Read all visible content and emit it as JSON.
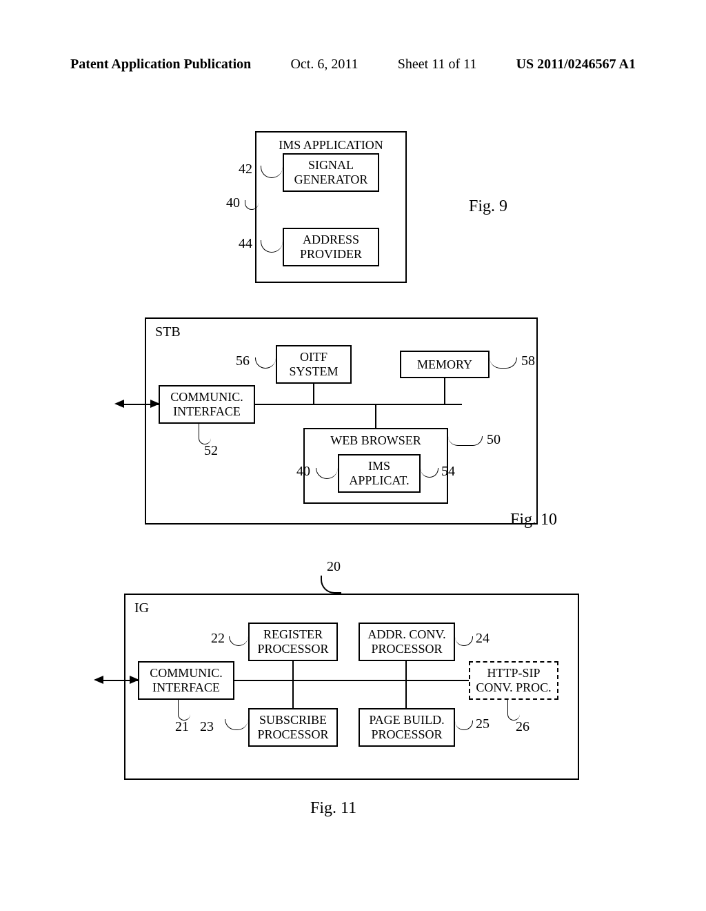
{
  "header": {
    "left": "Patent Application Publication",
    "date": "Oct. 6, 2011",
    "sheet": "Sheet 11 of 11",
    "pubno": "US 2011/0246567 A1"
  },
  "fig9": {
    "title": "IMS APPLICATION",
    "sig_gen": "SIGNAL\nGENERATOR",
    "addr_prov": "ADDRESS\nPROVIDER",
    "ref42": "42",
    "ref40": "40",
    "ref44": "44",
    "caption": "Fig. 9"
  },
  "fig10": {
    "corner": "STB",
    "oitf": "OITF\nSYSTEM",
    "memory": "MEMORY",
    "comm": "COMMUNIC.\nINTERFACE",
    "web": "WEB BROWSER",
    "ims": "IMS\nAPPLICAT.",
    "ref56": "56",
    "ref58": "58",
    "ref52": "52",
    "ref50": "50",
    "ref40": "40",
    "ref54": "54",
    "caption": "Fig. 10"
  },
  "fig11": {
    "corner": "IG",
    "ref20": "20",
    "register": "REGISTER\nPROCESSOR",
    "addrconv": "ADDR. CONV.\nPROCESSOR",
    "comm": "COMMUNIC.\nINTERFACE",
    "httpsip": "HTTP-SIP\nCONV. PROC.",
    "subscribe": "SUBSCRIBE\nPROCESSOR",
    "pagebuild": "PAGE BUILD.\nPROCESSOR",
    "ref22": "22",
    "ref24": "24",
    "ref21": "21",
    "ref23": "23",
    "ref25": "25",
    "ref26": "26",
    "caption": "Fig. 11"
  }
}
